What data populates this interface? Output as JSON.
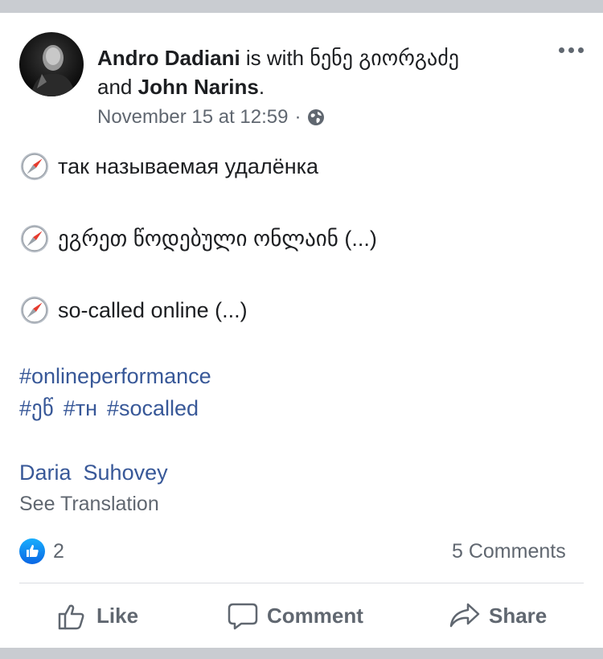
{
  "post": {
    "author": "Andro Dadiani",
    "with_text": "is with",
    "tagged_1": "ნენე გიორგაძე",
    "and_text": "and",
    "tagged_2": "John Narins",
    "period": ".",
    "timestamp": "November 15 at 12:59",
    "separator": "·",
    "lines": [
      "так называемая удалёнка",
      "ეგრეთ წოდებული ონლაინ (...)",
      "so-called online (...)"
    ],
    "hashtags_row1": [
      "#onlineperformance"
    ],
    "hashtags_row2": [
      "#ეწ",
      "#тн",
      "#socalled"
    ],
    "credit": "Daria  Suhovey",
    "see_translation": "See Translation"
  },
  "engagement": {
    "like_count": "2",
    "comments": "5 Comments"
  },
  "actions": {
    "like": "Like",
    "comment": "Comment",
    "share": "Share"
  },
  "colors": {
    "link": "#385898",
    "secondary_text": "#606770",
    "like_blue": "#1877f2"
  },
  "icons": {
    "more": "more-horizontal-icon",
    "audience": "globe-icon",
    "bullet": "compass-icon",
    "reaction": "like-reaction-icon",
    "like": "thumbs-up-icon",
    "comment": "speech-bubble-icon",
    "share": "share-arrow-icon"
  }
}
